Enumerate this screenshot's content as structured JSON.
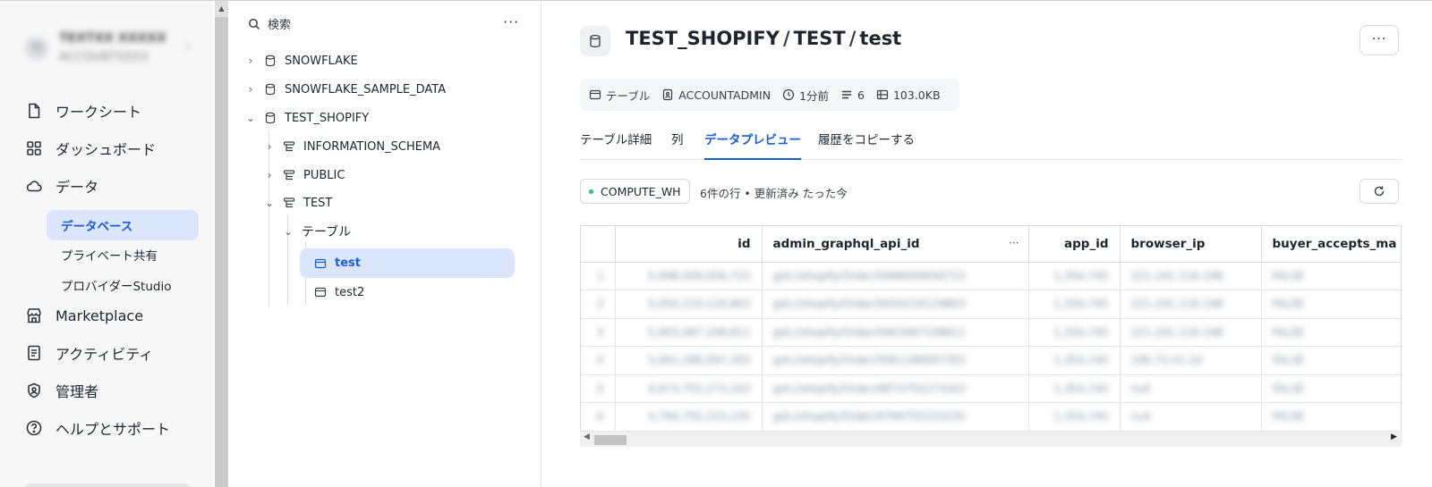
{
  "account": {
    "name": "TEXTXX XXXXX",
    "sub": "ACCOUNTXXXX",
    "initials": "TE"
  },
  "nav": {
    "worksheets": "ワークシート",
    "dashboards": "ダッシュボード",
    "data": "データ",
    "data_sub": {
      "databases": "データベース",
      "private_sharing": "プライベート共有",
      "provider_studio": "プロバイダーStudio"
    },
    "marketplace": "Marketplace",
    "activity": "アクティビティ",
    "admin": "管理者",
    "help": "ヘルプとサポート"
  },
  "explorer": {
    "search_label": "検索",
    "more": "···",
    "tree": {
      "db1": "SNOWFLAKE",
      "db2": "SNOWFLAKE_SAMPLE_DATA",
      "db3": "TEST_SHOPIFY",
      "schema1": "INFORMATION_SCHEMA",
      "schema2": "PUBLIC",
      "schema3": "TEST",
      "tables_group": "テーブル",
      "table1": "test",
      "table2": "test2"
    }
  },
  "main": {
    "breadcrumb": {
      "db": "TEST_SHOPIFY",
      "schema": "TEST",
      "table": "test",
      "sep": "/"
    },
    "more": "···",
    "meta": {
      "type": "テーブル",
      "owner": "ACCOUNTADMIN",
      "updated": "1分前",
      "columns": "6",
      "size": "103.0KB"
    },
    "tabs": {
      "details": "テーブル詳細",
      "columns": "列",
      "preview": "データプレビュー",
      "copy_history": "履歴をコピーする"
    },
    "warehouse": "COMPUTE_WH",
    "rows_info": "6件の行 • 更新済み たった今",
    "grid": {
      "headers": {
        "id": "id",
        "admin": "admin_graphql_api_id",
        "app": "app_id",
        "ip": "browser_ip",
        "buyer": "buyer_accepts_ma"
      },
      "col_more": "···",
      "rows": [
        {
          "n": "1",
          "id": "5,998,009,056,715",
          "admin": "gid://shopify/Order/5998009056715",
          "app": "1,354,745",
          "ip": "221.241.116.198",
          "buyer": "FALSE"
        },
        {
          "n": "2",
          "id": "5,054,219,129,803",
          "admin": "gid://shopify/Order/5054219129803",
          "app": "1,354,745",
          "ip": "221.241.116.198",
          "buyer": "FALSE"
        },
        {
          "n": "3",
          "id": "5,903,487,108,811",
          "admin": "gid://shopify/Order/5903487108811",
          "app": "1,354,745",
          "ip": "221.241.116.198",
          "buyer": "FALSE"
        },
        {
          "n": "4",
          "id": "5,061,186,097,355",
          "admin": "gid://shopify/Order/5061186097355",
          "app": "1,354,745",
          "ip": "106.73.41.10",
          "buyer": "FALSE"
        },
        {
          "n": "5",
          "id": "4,873,755,273,163",
          "admin": "gid://shopify/Order/4873755273163",
          "app": "1,354,745",
          "ip": "null",
          "buyer": "FALSE"
        },
        {
          "n": "6",
          "id": "4,794,755,153,235",
          "admin": "gid://shopify/Order/4794755153235",
          "app": "1,354,745",
          "ip": "null",
          "buyer": "FALSE"
        }
      ]
    }
  }
}
